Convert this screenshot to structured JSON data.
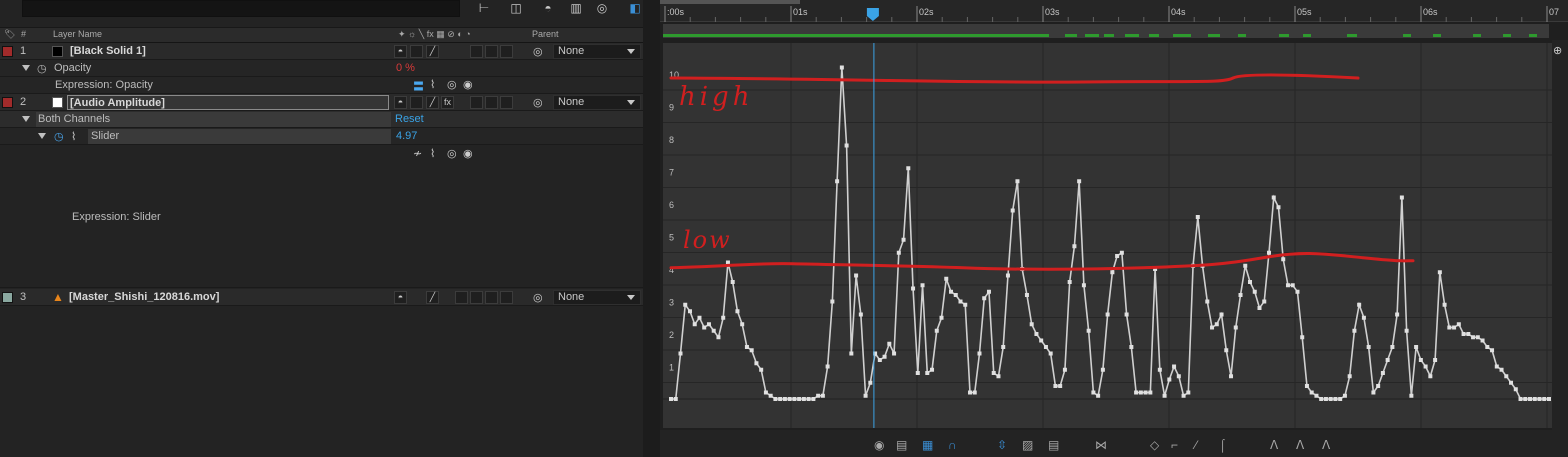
{
  "toolbar": {
    "search_icon": "search-icon",
    "search_placeholder": ""
  },
  "columns": {
    "number": "#",
    "layer_name": "Layer Name",
    "parent": "Parent"
  },
  "layers": [
    {
      "index": "1",
      "name": "[Black Solid 1]",
      "label_color": "#a12b2b",
      "swatch_color": "#000000",
      "parent": "None"
    },
    {
      "index": "2",
      "name": "[Audio Amplitude]",
      "label_color": "#a12b2b",
      "swatch_color": "#ffffff",
      "parent": "None"
    },
    {
      "index": "3",
      "name": "[Master_Shishi_120816.mov]",
      "label_color": "#8aa8a0",
      "parent": "None"
    }
  ],
  "properties": {
    "opacity_label": "Opacity",
    "opacity_value": "0 %",
    "expression_opacity": "Expression: Opacity",
    "both_channels": "Both Channels",
    "reset": "Reset",
    "slider_label": "Slider",
    "slider_value": "4.97",
    "expression_slider": "Expression: Slider"
  },
  "timeline": {
    "ticks": [
      ":00s",
      "01s",
      "02s",
      "03s",
      "04s",
      "05s",
      "06s",
      "07"
    ],
    "playhead_time_sec": 1.65
  },
  "graph": {
    "y_ticks": [
      "10",
      "9",
      "8",
      "7",
      "6",
      "5",
      "4",
      "3",
      "2",
      "1"
    ],
    "annotations": {
      "high": "high",
      "low": "low"
    },
    "curve_color": "#d0d0d0",
    "annotation_color": "#d11f1f",
    "high_line_value": 10,
    "low_line_value": 4.1,
    "values": [
      0,
      0,
      1.4,
      2.9,
      2.7,
      2.3,
      2.5,
      2.2,
      2.3,
      2.1,
      1.9,
      2.5,
      4.2,
      3.6,
      2.7,
      2.3,
      1.6,
      1.5,
      1.1,
      0.9,
      0.2,
      0.1,
      0.0,
      0.0,
      0.0,
      0.0,
      0.0,
      0.0,
      0.0,
      0.0,
      0.0,
      0.1,
      0.1,
      1.0,
      3.0,
      6.7,
      10.2,
      7.8,
      1.4,
      3.8,
      2.6,
      0.1,
      0.5,
      1.4,
      1.2,
      1.3,
      1.7,
      1.4,
      4.5,
      4.9,
      7.1,
      3.4,
      0.8,
      3.5,
      0.8,
      0.9,
      2.1,
      2.5,
      3.7,
      3.3,
      3.2,
      3.0,
      2.9,
      0.2,
      0.2,
      1.4,
      3.1,
      3.3,
      0.8,
      0.7,
      1.6,
      3.8,
      5.8,
      6.7,
      4.0,
      3.2,
      2.3,
      2.0,
      1.8,
      1.6,
      1.4,
      0.4,
      0.4,
      0.9,
      3.6,
      4.7,
      6.7,
      3.5,
      2.1,
      0.2,
      0.1,
      0.9,
      2.6,
      3.9,
      4.4,
      4.5,
      2.6,
      1.6,
      0.2,
      0.2,
      0.2,
      0.2,
      4.0,
      0.9,
      0.1,
      0.6,
      1.0,
      0.7,
      0.1,
      0.2,
      4.1,
      5.6,
      4.1,
      3.0,
      2.2,
      2.3,
      2.6,
      1.5,
      0.7,
      2.2,
      3.2,
      4.1,
      3.6,
      3.3,
      2.8,
      3.0,
      4.5,
      6.2,
      5.9,
      4.3,
      3.5,
      3.5,
      3.3,
      1.9,
      0.4,
      0.2,
      0.1,
      0.0,
      0.0,
      0.0,
      0.0,
      0.0,
      0.1,
      0.7,
      2.1,
      2.9,
      2.5,
      1.6,
      0.2,
      0.4,
      0.8,
      1.2,
      1.6,
      2.6,
      6.2,
      2.1,
      0.1,
      1.6,
      1.2,
      1.0,
      0.7,
      1.2,
      3.9,
      2.9,
      2.2,
      2.2,
      2.3,
      2.0,
      2.0,
      1.9,
      1.9,
      1.8,
      1.6,
      1.5,
      1.0,
      0.9,
      0.7,
      0.5,
      0.3,
      0.0,
      0.0,
      0.0,
      0.0,
      0.0,
      0.0,
      0.0
    ]
  },
  "bottom_toolbar": {
    "icons": [
      "eye-icon",
      "graph-options-icon",
      "transform-box-icon",
      "snap-icon",
      "fit-selection-icon",
      "fit-all-icon",
      "edit-speed-icon",
      "separate-dimensions-icon",
      "keyframe-icon",
      "hold-icon",
      "linear-icon",
      "auto-bezier-icon",
      "easy-ease-icon",
      "easy-ease-in-icon",
      "easy-ease-out-icon"
    ]
  }
}
